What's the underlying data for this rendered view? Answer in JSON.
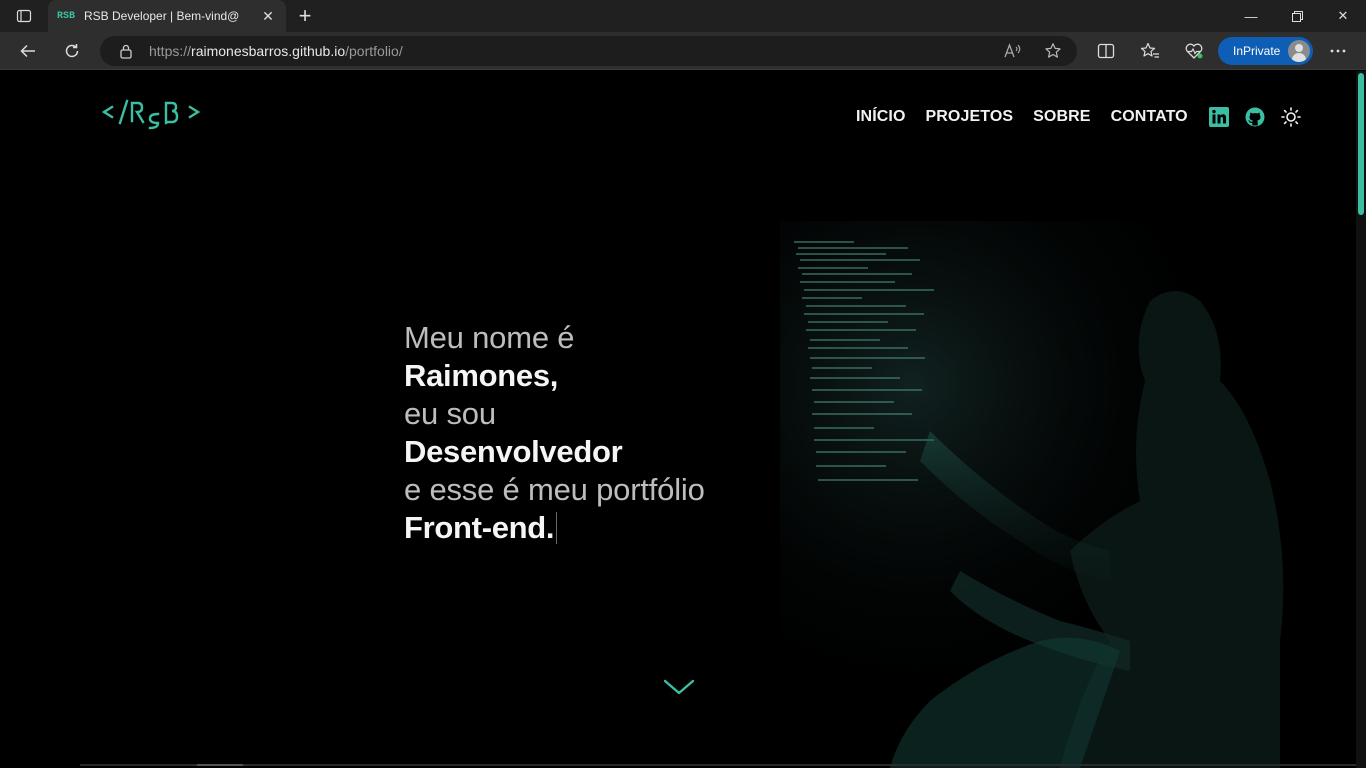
{
  "browser": {
    "tab_title": "RSB Developer | Bem-vind@",
    "favicon_text": "RSB",
    "url_prefix": "https://",
    "url_host": "raimonesbarros.github.io",
    "url_path": "/portfolio/",
    "inprivate_label": "InPrivate"
  },
  "site": {
    "logo_text": "</RSB>",
    "accent_color": "#3bbfa3",
    "nav": {
      "items": [
        "INÍCIO",
        "PROJETOS",
        "SOBRE",
        "CONTATO"
      ],
      "icons": [
        "linkedin-icon",
        "github-icon",
        "theme-toggle-sun-icon"
      ]
    },
    "hero": {
      "line1": "Meu nome é",
      "line2": "Raimones,",
      "line3": "eu sou",
      "line4": "Desenvolvedor",
      "line5": "e esse é meu portfólio",
      "line6": "Front-end."
    },
    "scroll_icon": "chevron-down-icon"
  }
}
